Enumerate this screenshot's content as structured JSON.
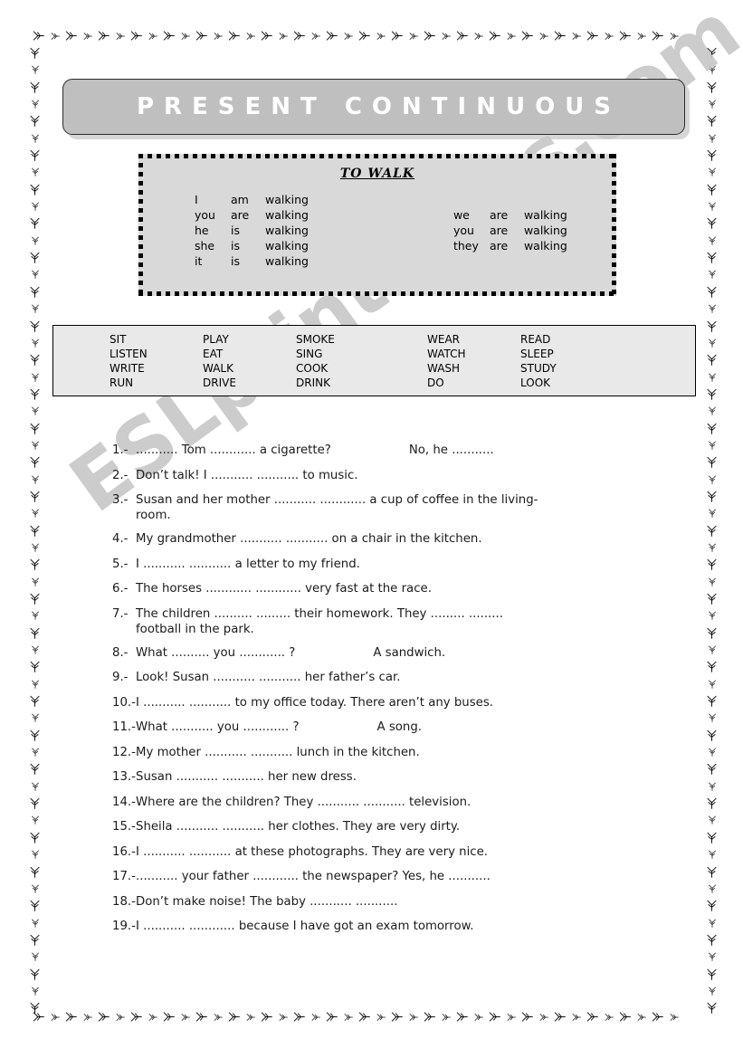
{
  "page": {
    "watermark": "ESLprintables.com",
    "border_icon": "bird-track-icon"
  },
  "banner": {
    "title": "PRESENT CONTINUOUS",
    "bg_color": "#bfbfbf",
    "text_color": "#ffffff"
  },
  "conjugation": {
    "title": "TO  WALK",
    "bg_color": "#d9d9d9",
    "left": [
      {
        "subject": "I",
        "aux": "am",
        "verb": "walking"
      },
      {
        "subject": "you",
        "aux": "are",
        "verb": "walking"
      },
      {
        "subject": "he",
        "aux": "is",
        "verb": "walking"
      },
      {
        "subject": "she",
        "aux": "is",
        "verb": "walking"
      },
      {
        "subject": "it",
        "aux": "is",
        "verb": "walking"
      }
    ],
    "right": [
      {
        "subject": "we",
        "aux": "are",
        "verb": "walking"
      },
      {
        "subject": "you",
        "aux": "are",
        "verb": "walking"
      },
      {
        "subject": "they",
        "aux": "are",
        "verb": "walking"
      }
    ]
  },
  "verbs": {
    "bg_color": "#e9e9e9",
    "columns": [
      [
        "SIT",
        "LISTEN",
        "WRITE",
        "RUN"
      ],
      [
        "PLAY",
        "EAT",
        "WALK",
        "DRIVE"
      ],
      [
        "SMOKE",
        "SING",
        "COOK",
        "DRINK"
      ],
      [
        "WEAR",
        "WATCH",
        "WASH",
        "DO"
      ],
      [
        "READ",
        "SLEEP",
        "STUDY",
        "LOOK"
      ]
    ]
  },
  "exercises": [
    {
      "num": "1.-",
      "text": "........... Tom ............ a cigarette?",
      "tail": "No, he ..........."
    },
    {
      "num": "2.-",
      "text": "Don’t talk!  I ...........  ........... to music."
    },
    {
      "num": "3.-",
      "text": "Susan and her mother ...........  ............ a cup of coffee in the living-",
      "cont": "room."
    },
    {
      "num": "4.-",
      "text": "My grandmother ...........  ........... on a chair in the kitchen."
    },
    {
      "num": "5.-",
      "text": "I ...........  ........... a letter to my friend."
    },
    {
      "num": "6.-",
      "text": "The horses  ............ ............ very fast at the race."
    },
    {
      "num": "7.-",
      "text": "The children ..........  ......... their homework. They .........   .........",
      "cont": "football in the park."
    },
    {
      "num": "8.-",
      "text": "What ..........  you ............ ?",
      "tail": "A sandwich."
    },
    {
      "num": "9.-",
      "text": "Look!  Susan ...........  ........... her father’s car."
    },
    {
      "num": "10.-",
      "text": "I ...........  ........... to my office today. There aren’t any buses."
    },
    {
      "num": "11.-",
      "text": "What ........... you ............ ?",
      "tail": "A song."
    },
    {
      "num": "12.-",
      "text": "My mother ...........  ...........   lunch in the kitchen."
    },
    {
      "num": "13.-",
      "text": "Susan ...........  ........... her new dress."
    },
    {
      "num": "14.-",
      "text": "Where are the children?     They ...........  ........... television."
    },
    {
      "num": "15.-",
      "text": "Sheila ...........  ........... her clothes. They are very dirty."
    },
    {
      "num": "16.-",
      "text": "I ...........   ........... at these photographs. They are very nice."
    },
    {
      "num": "17.-",
      "text": "........... your father ............ the newspaper? Yes, he ..........."
    },
    {
      "num": "18.-",
      "text": "Don’t make noise!  The baby ...........  ..........."
    },
    {
      "num": "19.-",
      "text": "I ...........  ............ because I have got an exam tomorrow."
    }
  ]
}
